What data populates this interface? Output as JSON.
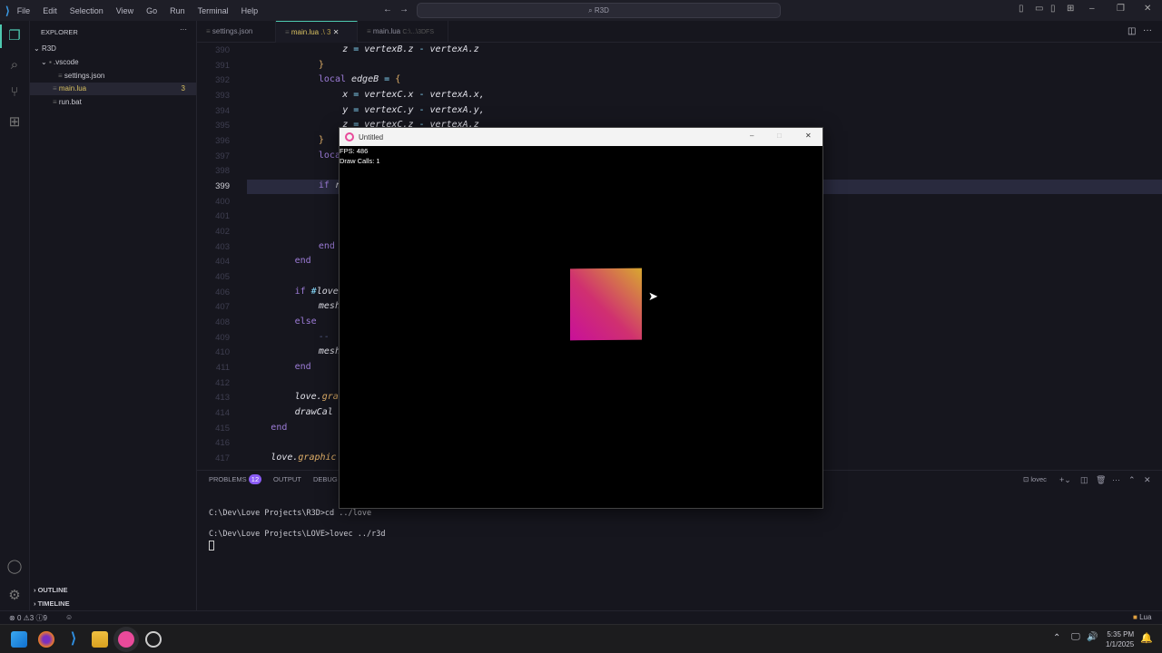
{
  "titlebar": {
    "menu": [
      "File",
      "Edit",
      "Selection",
      "View",
      "Go",
      "Run",
      "Terminal",
      "Help"
    ],
    "search": "R3D"
  },
  "explorer": {
    "title": "EXPLORER",
    "root": "R3D",
    "items": [
      {
        "name": ".vscode",
        "type": "folder"
      },
      {
        "name": "settings.json",
        "type": "file"
      },
      {
        "name": "main.lua",
        "type": "file",
        "badge": "3"
      },
      {
        "name": "run.bat",
        "type": "file"
      }
    ],
    "outline": "OUTLINE",
    "timeline": "TIMELINE"
  },
  "tabs": [
    {
      "label": "settings.json"
    },
    {
      "label": "main.lua",
      "suffix": ".\\ 3",
      "active": true
    },
    {
      "label": "main.lua",
      "suffix": "C:\\...\\3DFS"
    }
  ],
  "editor": {
    "current_line": "399",
    "lines": [
      {
        "n": "390",
        "i": 4,
        "t": [
          [
            "z",
            "v"
          ],
          [
            " = ",
            "op"
          ],
          [
            "vertexB.z",
            "v"
          ],
          [
            " - ",
            "op"
          ],
          [
            "vertexA.z",
            "v"
          ]
        ]
      },
      {
        "n": "391",
        "i": 3,
        "t": [
          [
            "}",
            "br"
          ]
        ]
      },
      {
        "n": "392",
        "i": 3,
        "t": [
          [
            "local ",
            "kw"
          ],
          [
            "edgeB",
            "v"
          ],
          [
            " = ",
            "op"
          ],
          [
            "{",
            "br"
          ]
        ]
      },
      {
        "n": "393",
        "i": 4,
        "t": [
          [
            "x",
            "v"
          ],
          [
            " = ",
            "op"
          ],
          [
            "vertexC.x",
            "v"
          ],
          [
            " - ",
            "op"
          ],
          [
            "vertexA.x,",
            "v"
          ]
        ]
      },
      {
        "n": "394",
        "i": 4,
        "t": [
          [
            "y",
            "v"
          ],
          [
            " = ",
            "op"
          ],
          [
            "vertexC.y",
            "v"
          ],
          [
            " - ",
            "op"
          ],
          [
            "vertexA.y,",
            "v"
          ]
        ]
      },
      {
        "n": "395",
        "i": 4,
        "t": [
          [
            "z",
            "v"
          ],
          [
            " = ",
            "op"
          ],
          [
            "vertexC.z",
            "v"
          ],
          [
            " - ",
            "op"
          ],
          [
            "vertexA.z",
            "v"
          ]
        ]
      },
      {
        "n": "396",
        "i": 3,
        "t": [
          [
            "}",
            "br"
          ]
        ]
      },
      {
        "n": "397",
        "i": 3,
        "t": [
          [
            "local",
            "kw"
          ]
        ]
      },
      {
        "n": "398",
        "i": 3,
        "t": []
      },
      {
        "n": "399",
        "i": 3,
        "t": [
          [
            "if ",
            "kw"
          ],
          [
            "r",
            "v"
          ]
        ]
      },
      {
        "n": "400",
        "i": 3,
        "t": []
      },
      {
        "n": "401",
        "i": 3,
        "t": []
      },
      {
        "n": "402",
        "i": 3,
        "t": []
      },
      {
        "n": "403",
        "i": 3,
        "t": [
          [
            "end",
            "kw"
          ]
        ]
      },
      {
        "n": "404",
        "i": 2,
        "t": [
          [
            "end",
            "kw"
          ]
        ]
      },
      {
        "n": "405",
        "i": 2,
        "t": []
      },
      {
        "n": "406",
        "i": 2,
        "t": [
          [
            "if ",
            "kw"
          ],
          [
            "#",
            "op"
          ],
          [
            "love",
            "v"
          ]
        ]
      },
      {
        "n": "407",
        "i": 3,
        "t": [
          [
            "mesh",
            "v"
          ]
        ]
      },
      {
        "n": "408",
        "i": 2,
        "t": [
          [
            "else",
            "kw"
          ]
        ]
      },
      {
        "n": "409",
        "i": 3,
        "t": [
          [
            "-- ",
            "cm"
          ]
        ]
      },
      {
        "n": "410",
        "i": 3,
        "t": [
          [
            "mesh",
            "v"
          ]
        ]
      },
      {
        "n": "411",
        "i": 2,
        "t": [
          [
            "end",
            "kw"
          ]
        ]
      },
      {
        "n": "412",
        "i": 2,
        "t": []
      },
      {
        "n": "413",
        "i": 2,
        "t": [
          [
            "love.",
            "v"
          ],
          [
            "gra",
            "fn"
          ]
        ]
      },
      {
        "n": "414",
        "i": 2,
        "t": [
          [
            "drawCal",
            "v"
          ]
        ]
      },
      {
        "n": "415",
        "i": 1,
        "t": [
          [
            "end",
            "kw"
          ]
        ]
      },
      {
        "n": "416",
        "i": 1,
        "t": []
      },
      {
        "n": "417",
        "i": 1,
        "t": [
          [
            "love.",
            "v"
          ],
          [
            "graphic",
            "fn"
          ]
        ]
      }
    ]
  },
  "panel": {
    "tabs": [
      "PROBLEMS",
      "OUTPUT",
      "DEBUG C"
    ],
    "problems_count": "12",
    "terminal_name": "lovec",
    "terminal_lines": [
      "C:\\Dev\\Love Projects\\R3D>cd ../love",
      "C:\\Dev\\Love Projects\\LOVE>lovec ../r3d"
    ]
  },
  "love_window": {
    "title": "Untitled",
    "fps": "FPS: 486",
    "draw_calls": "Draw Calls: 1"
  },
  "status": {
    "errors": "0",
    "warnings": "3",
    "info": "9",
    "language": "Lua"
  },
  "taskbar": {
    "time": "5:35 PM",
    "date": "1/1/2025"
  },
  "colors": {
    "accent": "#4ec9b0",
    "keyword": "#9d7cd8",
    "badge": "#8b5cf6"
  }
}
